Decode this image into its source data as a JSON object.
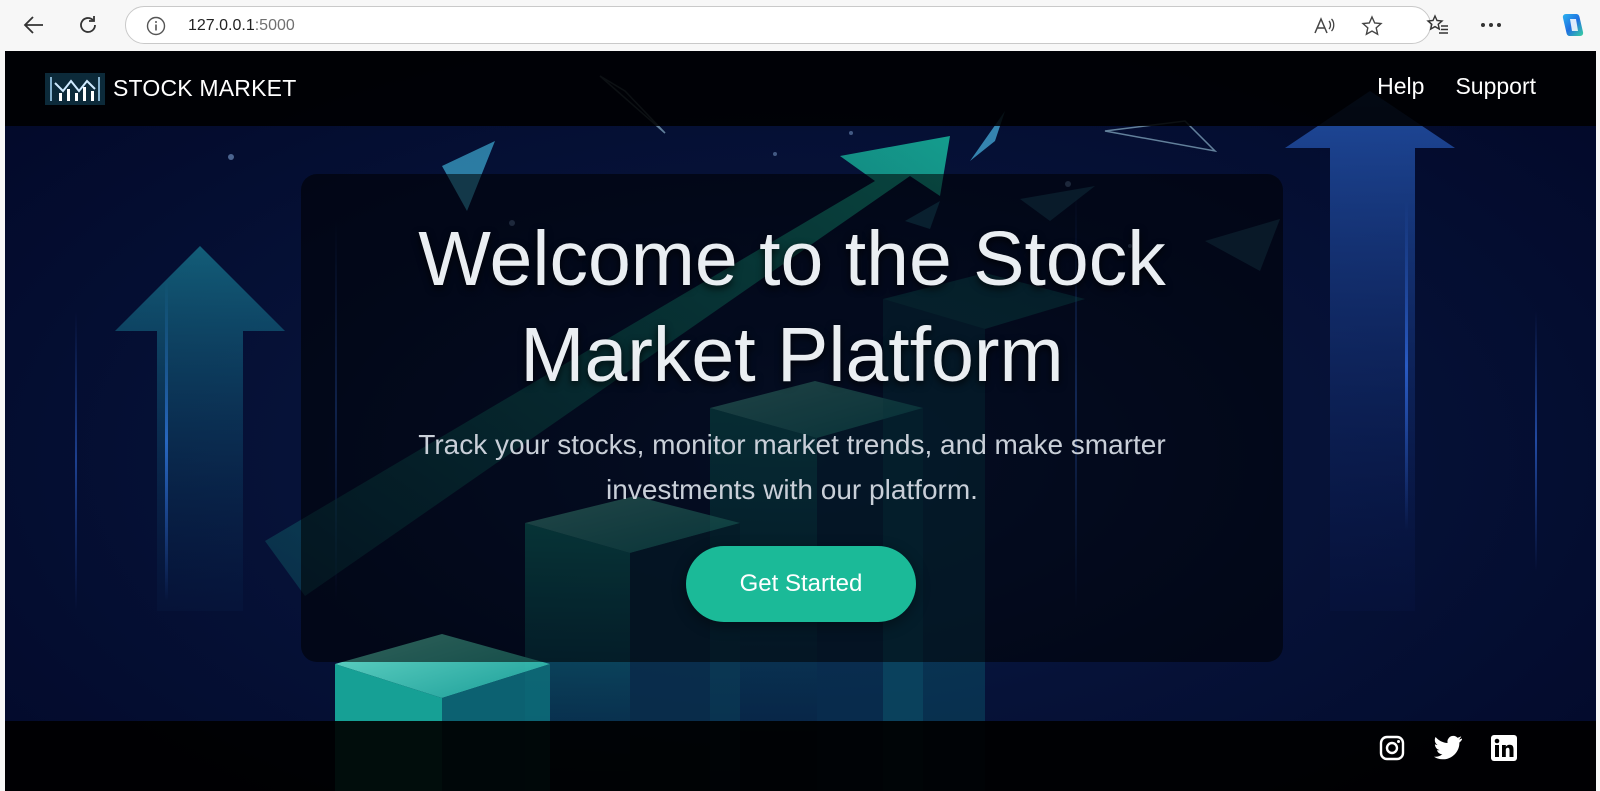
{
  "browser": {
    "url_host": "127.0.0.1",
    "url_port": ":5000",
    "back_icon": "back-arrow-icon",
    "refresh_icon": "refresh-icon",
    "info_icon": "info-icon",
    "read_aloud_icon": "read-aloud-icon",
    "favorite_icon": "star-icon",
    "favorites_icon": "favorites-list-icon",
    "more_icon": "more-icon",
    "copilot_icon": "copilot-icon"
  },
  "header": {
    "brand": "STOCK MARKET",
    "menu": [
      {
        "label": "Help"
      },
      {
        "label": "Support"
      }
    ]
  },
  "hero": {
    "title_line1": "Welcome to the Stock",
    "title_line2": "Market Platform",
    "subtitle_line1": "Track your stocks, monitor market trends, and make smarter",
    "subtitle_line2": "investments with our platform.",
    "cta": "Get Started"
  },
  "footer": {
    "social": [
      {
        "name": "instagram-icon"
      },
      {
        "name": "twitter-icon"
      },
      {
        "name": "linkedin-icon"
      }
    ]
  },
  "colors": {
    "accent": "#1bba98",
    "background": "#061238",
    "bar": "#000000"
  }
}
